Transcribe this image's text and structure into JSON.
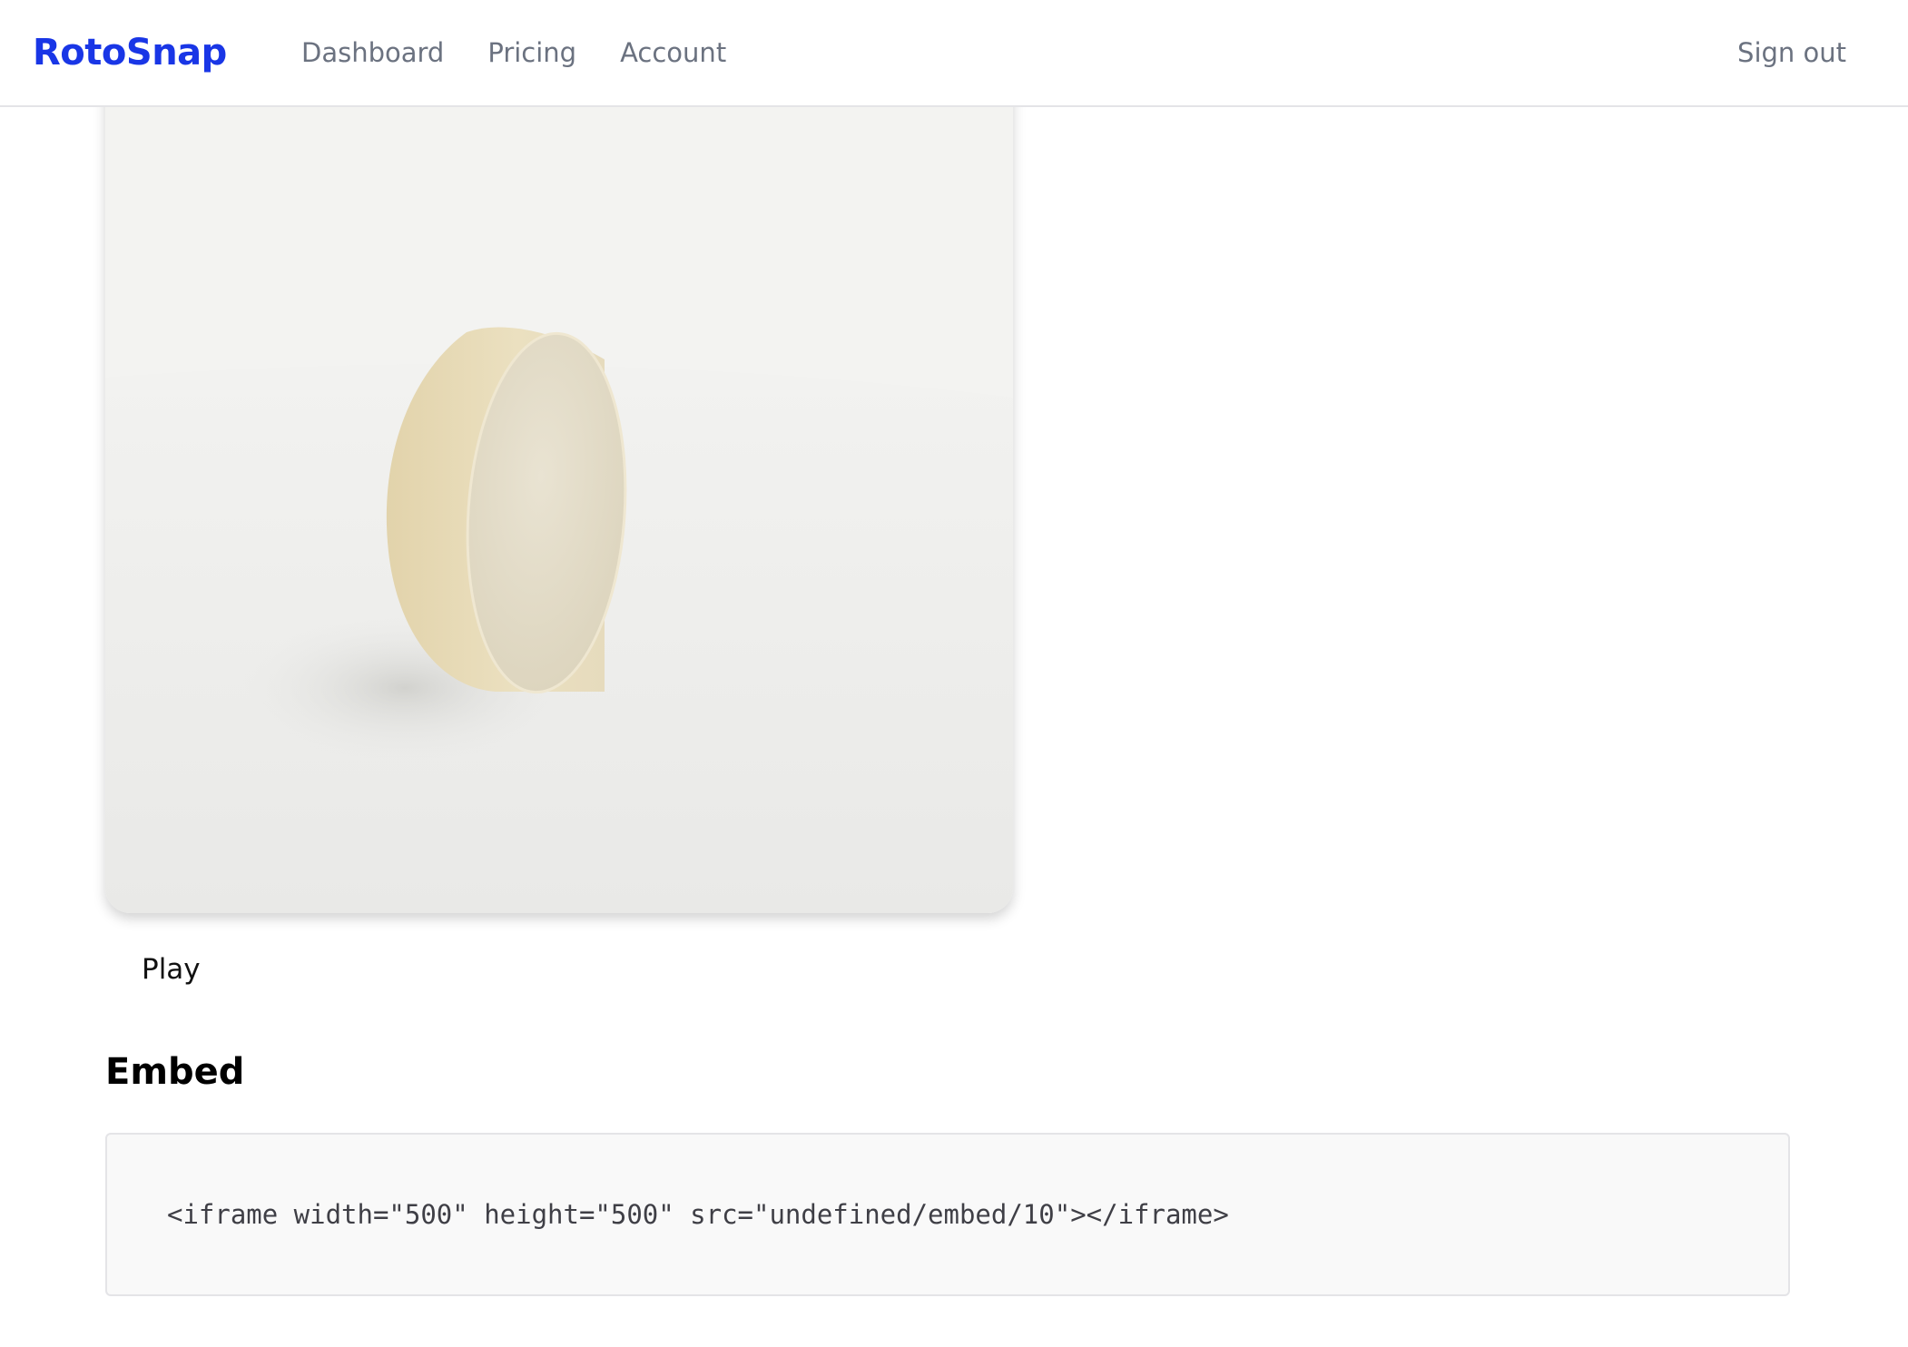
{
  "nav": {
    "logo": "RotoSnap",
    "links": [
      "Dashboard",
      "Pricing",
      "Account"
    ],
    "signout": "Sign out"
  },
  "preview": {
    "play_label": "Play"
  },
  "embed": {
    "title": "Embed",
    "code": "<iframe width=\"500\" height=\"500\" src=\"undefined/embed/10\"></iframe>"
  },
  "colors": {
    "brand": "#1936e6",
    "nav_text": "#6b7280"
  }
}
